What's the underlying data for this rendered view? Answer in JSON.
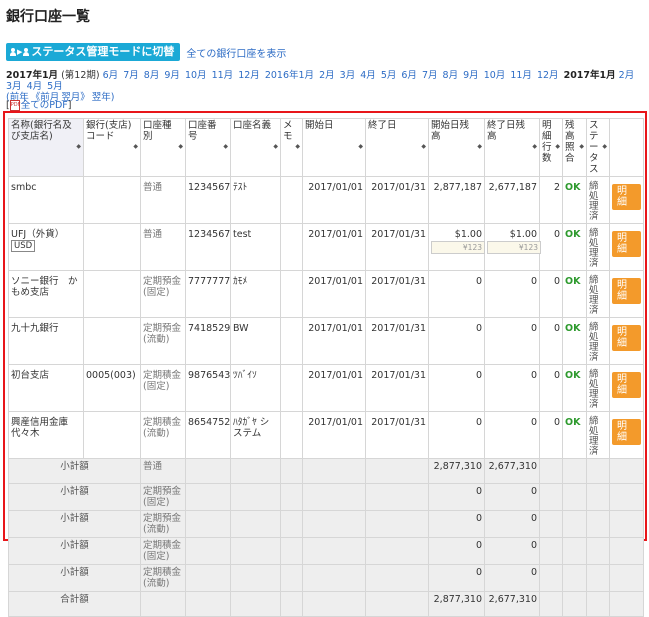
{
  "page": {
    "title": "銀行口座一覧"
  },
  "toolbar": {
    "mode_button": "ステータス管理モードに切替",
    "show_all_link": "全ての銀行口座を表示"
  },
  "period": {
    "current": "2017年1月",
    "period_no": "(第12期)",
    "months_a": [
      "6月",
      "7月",
      "8月",
      "9月",
      "10月",
      "11月",
      "12月",
      "2016年1月",
      "2月",
      "3月",
      "4月",
      "5月",
      "6月",
      "7月",
      "8月",
      "9月",
      "10月",
      "11月",
      "12月"
    ],
    "current2": "2017年1月",
    "months_b": [
      "2月",
      "3月",
      "4月",
      "5月"
    ],
    "nav_prefix": "(前年",
    "nav_prev": "《前月",
    "nav_next": "翌月》",
    "nav_suffix": "翌年)",
    "all_pdf": "全てのPDF"
  },
  "table": {
    "headers": [
      "名称(銀行名及び支店名)",
      "銀行(支店)コード",
      "口座種別",
      "口座番号",
      "口座名義",
      "メモ",
      "開始日",
      "終了日",
      "開始日残高",
      "終了日残高",
      "明細行数",
      "残高照合",
      "ステータス",
      ""
    ],
    "detail_label": "明細",
    "rows": [
      {
        "name": "smbc",
        "code": "",
        "type": "普通",
        "number": "1234567",
        "holder": "ﾃｽﾄ",
        "memo": "",
        "start": "2017/01/01",
        "end": "2017/01/31",
        "bal_start": "2,877,187",
        "bal_end": "2,677,187",
        "lines": "2",
        "check": "OK",
        "status": "締処理済"
      },
      {
        "name": "UFJ（外貨）",
        "currency": "USD",
        "code": "",
        "type": "普通",
        "number": "1234567",
        "holder": "test",
        "memo": "",
        "start": "2017/01/01",
        "end": "2017/01/31",
        "bal_start": "$1.00",
        "bal_end": "$1.00",
        "yen_start": "¥123",
        "yen_end": "¥123",
        "lines": "0",
        "check": "OK",
        "status": "締処理済"
      },
      {
        "name": "ソニー銀行　かもめ支店",
        "code": "",
        "type": "定期預金(固定)",
        "number": "7777777",
        "holder": "ｶﾓﾒ",
        "memo": "",
        "start": "2017/01/01",
        "end": "2017/01/31",
        "bal_start": "0",
        "bal_end": "0",
        "lines": "0",
        "check": "OK",
        "status": "締処理済"
      },
      {
        "name": "九十九銀行",
        "code": "",
        "type": "定期預金(流動)",
        "number": "7418529",
        "holder": "BW",
        "memo": "",
        "start": "2017/01/01",
        "end": "2017/01/31",
        "bal_start": "0",
        "bal_end": "0",
        "lines": "0",
        "check": "OK",
        "status": "締処理済"
      },
      {
        "name": "初台支店",
        "code": "0005(003)",
        "type": "定期積金(固定)",
        "number": "9876543",
        "holder": "ﾂﾊﾞｲｿ",
        "memo": "",
        "start": "2017/01/01",
        "end": "2017/01/31",
        "bal_start": "0",
        "bal_end": "0",
        "lines": "0",
        "check": "OK",
        "status": "締処理済"
      },
      {
        "name": "興産信用金庫　代々木",
        "code": "",
        "type": "定期積金(流動)",
        "number": "8654752",
        "holder": "ﾊﾀｶﾞﾔ システム",
        "memo": "",
        "start": "2017/01/01",
        "end": "2017/01/31",
        "bal_start": "0",
        "bal_end": "0",
        "lines": "0",
        "check": "OK",
        "status": "締処理済"
      }
    ],
    "subtotals": [
      {
        "label": "小計額",
        "type": "普通",
        "bal_start": "2,877,310",
        "bal_end": "2,677,310"
      },
      {
        "label": "小計額",
        "type": "定期預金(固定)",
        "bal_start": "0",
        "bal_end": "0"
      },
      {
        "label": "小計額",
        "type": "定期預金(流動)",
        "bal_start": "0",
        "bal_end": "0"
      },
      {
        "label": "小計額",
        "type": "定期積金(固定)",
        "bal_start": "0",
        "bal_end": "0"
      },
      {
        "label": "小計額",
        "type": "定期積金(流動)",
        "bal_start": "0",
        "bal_end": "0"
      }
    ],
    "total": {
      "label": "合計額",
      "bal_start": "2,877,310",
      "bal_end": "2,677,310"
    }
  },
  "colors": {
    "accent": "#1ba9d6",
    "detail_button": "#f39a2b",
    "ok": "#2e9a2e",
    "highlight_frame": "#e8161a"
  }
}
